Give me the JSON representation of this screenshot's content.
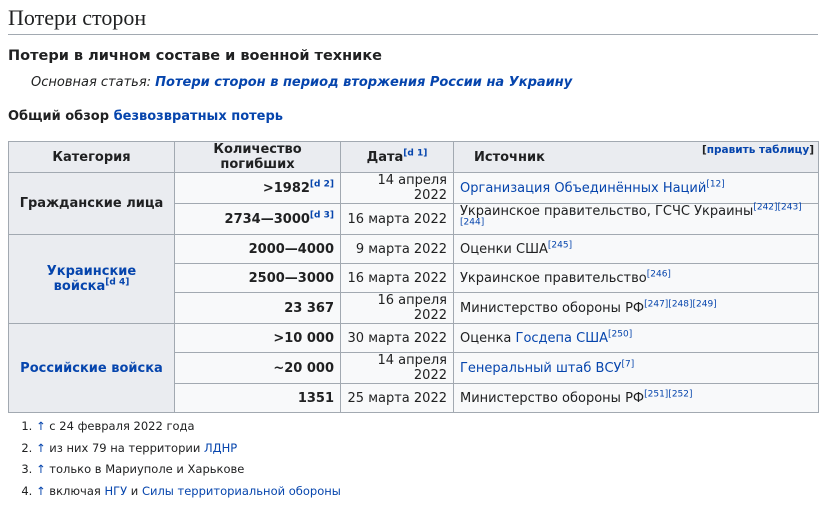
{
  "heading": "Потери сторон",
  "subheading": "Потери в личном составе и военной технике",
  "hatnote": {
    "prefix": "Основная статья: ",
    "link": "Потери сторон в период вторжения России на Украину"
  },
  "overview": {
    "text": "Общий обзор ",
    "link": "безвозвратных потерь"
  },
  "table": {
    "edit_label": "править таблицу",
    "headers": {
      "category": "Категория",
      "deaths": "Количество погибших",
      "date": "Дата",
      "date_ref": "[d 1]",
      "source": "Источник"
    },
    "groups": [
      {
        "category": "Гражданские лица",
        "category_ref": "",
        "rows": [
          {
            "count": ">1982",
            "count_ref": "[d 2]",
            "date": "14 апреля 2022",
            "source_pre": "",
            "source_link": "Организация Объединённых Наций",
            "source_post": "",
            "refs": "[12]"
          },
          {
            "count": "2734—3000",
            "count_ref": "[d 3]",
            "date": "16 марта 2022",
            "source_pre": "Украинское правительство, ГСЧС Украины",
            "source_link": "",
            "source_post": "",
            "refs": "[242][243][244]"
          }
        ]
      },
      {
        "category": "Украинские войска",
        "category_ref": "[d 4]",
        "rows": [
          {
            "count": "2000—4000",
            "count_ref": "",
            "date": "9 марта 2022",
            "source_pre": "Оценки США",
            "source_link": "",
            "source_post": "",
            "refs": "[245]"
          },
          {
            "count": "2500—3000",
            "count_ref": "",
            "date": "16 марта 2022",
            "source_pre": "Украинское правительство",
            "source_link": "",
            "source_post": "",
            "refs": "[246]"
          },
          {
            "count": "23 367",
            "count_ref": "",
            "date": "16 апреля 2022",
            "source_pre": "Министерство обороны РФ",
            "source_link": "",
            "source_post": "",
            "refs": "[247][248][249]"
          }
        ]
      },
      {
        "category": "Российские войска",
        "category_ref": "",
        "rows": [
          {
            "count": ">10 000",
            "count_ref": "",
            "date": "30 марта 2022",
            "source_pre": "Оценка ",
            "source_link": "Госдепа США",
            "source_post": "",
            "refs": "[250]"
          },
          {
            "count": "~20 000",
            "count_ref": "",
            "date": "14 апреля 2022",
            "source_pre": "",
            "source_link": "Генеральный штаб ВСУ",
            "source_post": "",
            "refs": "[7]"
          },
          {
            "count": "1351",
            "count_ref": "",
            "date": "25 марта 2022",
            "source_pre": "Министерство обороны РФ",
            "source_link": "",
            "source_post": "",
            "refs": "[251][252]"
          }
        ]
      }
    ]
  },
  "notes": [
    {
      "arrow": "↑",
      "pre": " с 24 февраля 2022 года",
      "link": "",
      "mid": "",
      "link2": ""
    },
    {
      "arrow": "↑",
      "pre": " из них 79 на территории ",
      "link": "ЛДНР",
      "mid": "",
      "link2": ""
    },
    {
      "arrow": "↑",
      "pre": " только в Мариуполе и Харькове",
      "link": "",
      "mid": "",
      "link2": ""
    },
    {
      "arrow": "↑",
      "pre": " включая ",
      "link": "НГУ",
      "mid": " и ",
      "link2": "Силы территориальной обороны"
    }
  ]
}
